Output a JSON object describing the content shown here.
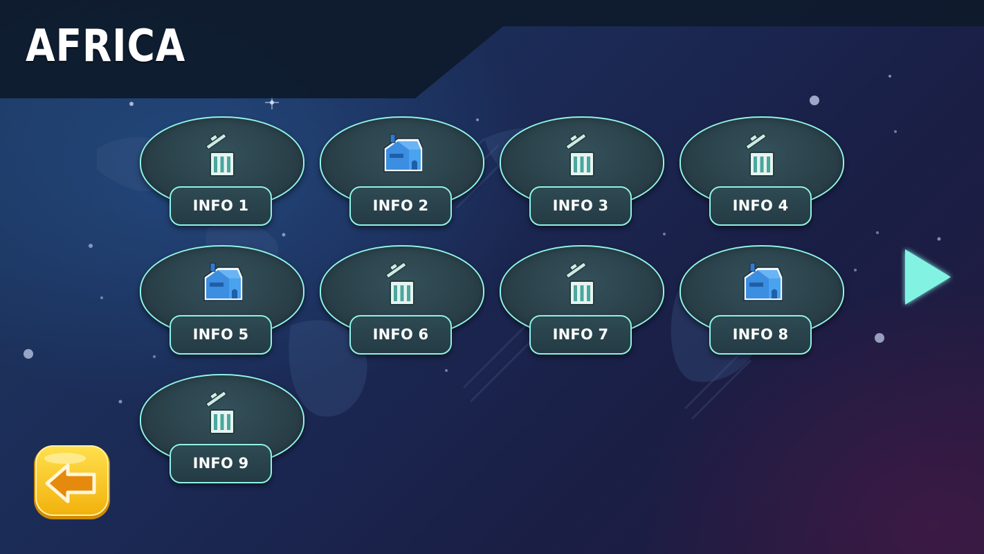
{
  "header": {
    "title": "AFRICA"
  },
  "levels": [
    {
      "label": "INFO 1",
      "icon": "trash-can-icon"
    },
    {
      "label": "INFO 2",
      "icon": "house-icon"
    },
    {
      "label": "INFO 3",
      "icon": "trash-can-icon"
    },
    {
      "label": "INFO 4",
      "icon": "trash-can-icon"
    },
    {
      "label": "INFO 5",
      "icon": "house-icon"
    },
    {
      "label": "INFO 6",
      "icon": "trash-can-icon"
    },
    {
      "label": "INFO 7",
      "icon": "trash-can-icon"
    },
    {
      "label": "INFO 8",
      "icon": "house-icon"
    },
    {
      "label": "INFO 9",
      "icon": "trash-can-icon"
    }
  ],
  "navigation": {
    "next_icon": "play-triangle-icon",
    "back_icon": "back-arrow-icon"
  },
  "colors": {
    "accent_cyan": "#8ff4e6",
    "pod_fill": "#2a4049",
    "back_button_yellow": "#f6c417",
    "back_arrow_orange": "#e58a0c",
    "house_blue": "#4aa3ee"
  }
}
